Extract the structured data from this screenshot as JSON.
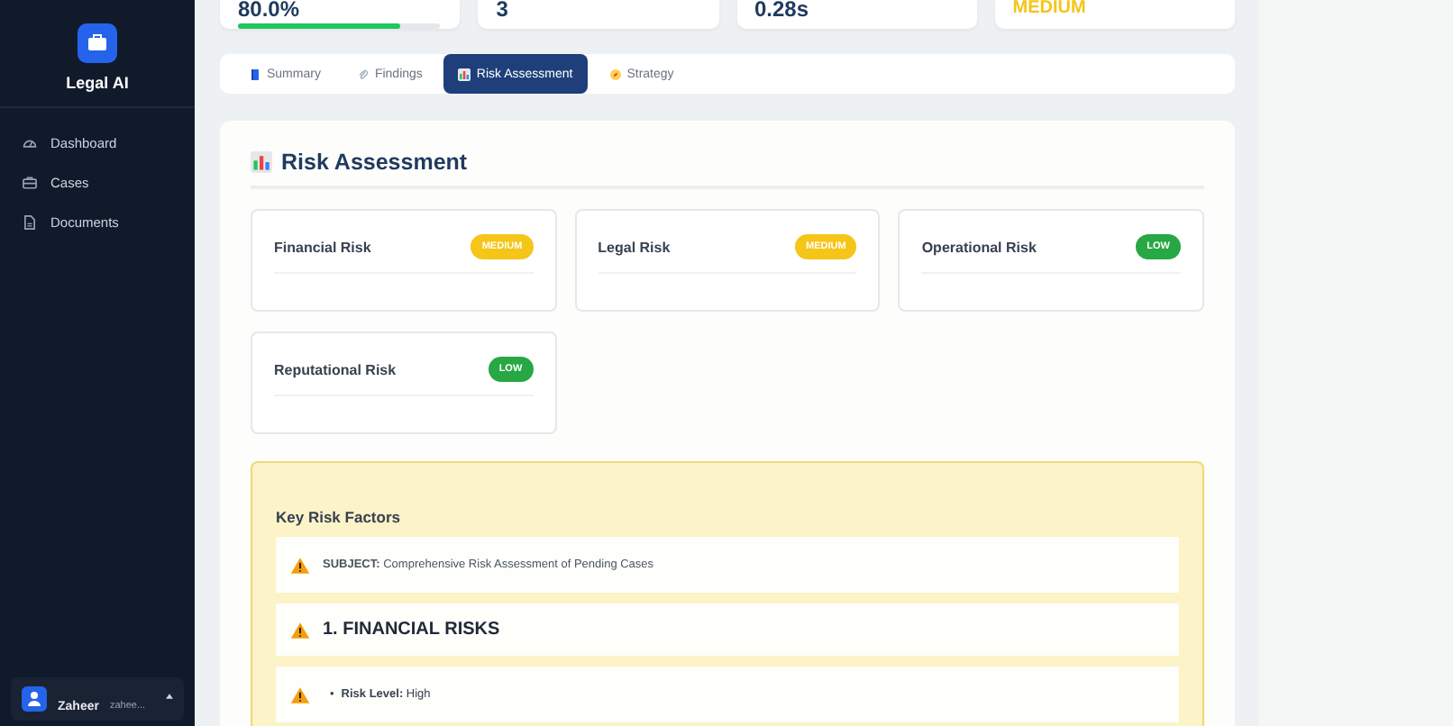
{
  "sidebar": {
    "brand": "Legal AI",
    "items": [
      {
        "label": "Dashboard",
        "selected": false
      },
      {
        "label": "Cases",
        "selected": false
      },
      {
        "label": "Documents",
        "selected": false
      }
    ],
    "user": {
      "name": "Zaheer",
      "email": "zahee..."
    }
  },
  "stats": [
    {
      "value": "80.0%",
      "kind": "progress",
      "level": 0.8
    },
    {
      "value": "3",
      "kind": "plain"
    },
    {
      "value": "0.28s",
      "kind": "plain"
    },
    {
      "value": "MEDIUM",
      "kind": "warning"
    }
  ],
  "tabs": [
    {
      "label": "Summary",
      "selected": false
    },
    {
      "label": "Findings",
      "selected": false
    },
    {
      "label": "Risk Assessment",
      "selected": true
    },
    {
      "label": "Strategy",
      "selected": false
    }
  ],
  "panel": {
    "title": "Risk Assessment",
    "risks": [
      {
        "name": "Financial Risk",
        "rating": "MEDIUM",
        "kind": "medium"
      },
      {
        "name": "Legal Risk",
        "rating": "MEDIUM",
        "kind": "medium"
      },
      {
        "name": "Operational Risk",
        "rating": "LOW",
        "kind": "low"
      },
      {
        "name": "Reputational Risk",
        "rating": "LOW",
        "kind": "low"
      }
    ],
    "factors": {
      "title": "Key Risk Factors",
      "items": [
        {
          "kind": "text",
          "text": "**SUBJECT:** Comprehensive Risk Assessment of Pending Cases"
        },
        {
          "kind": "heading",
          "text": "**1. FINANCIAL RISKS**"
        },
        {
          "kind": "bullet",
          "marker": "•",
          "text": "**Risk Level:** High"
        }
      ]
    }
  }
}
